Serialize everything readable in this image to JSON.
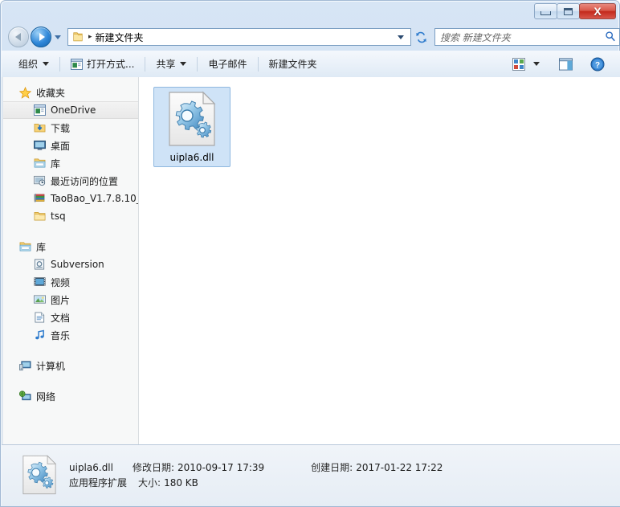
{
  "window": {
    "title": "",
    "buttons": {
      "minimize": "minimize",
      "maximize": "maximize",
      "close": "X"
    }
  },
  "address": {
    "back_label": "后退",
    "forward_label": "前进",
    "recent_label": "最近浏览的位置",
    "folder_icon": "folder-icon",
    "separator": "▸",
    "path": "新建文件夹",
    "dropdown_label": "地址栏下拉",
    "refresh_label": "刷新"
  },
  "search": {
    "placeholder": "搜索 新建文件夹",
    "icon": "search-icon"
  },
  "toolbar": {
    "organize": "组织",
    "open_with": "打开方式...",
    "share": "共享",
    "email": "电子邮件",
    "new_folder": "新建文件夹",
    "views_label": "更改您的视图",
    "preview_label": "显示预览窗格",
    "help_label": "帮助"
  },
  "sidebar": {
    "groups": [
      {
        "header": "收藏夹",
        "header_icon": "star-icon",
        "items": [
          {
            "label": "OneDrive",
            "icon": "onedrive-icon",
            "selected": true
          },
          {
            "label": "下载",
            "icon": "downloads-icon",
            "selected": false
          },
          {
            "label": "桌面",
            "icon": "desktop-icon",
            "selected": false
          },
          {
            "label": "库",
            "icon": "library-icon",
            "selected": false
          },
          {
            "label": "最近访问的位置",
            "icon": "recent-places-icon",
            "selected": false
          },
          {
            "label": "TaoBao_V1.7.8.10_",
            "icon": "books-icon",
            "selected": false
          },
          {
            "label": "tsq",
            "icon": "folder-icon",
            "selected": false
          }
        ]
      },
      {
        "header": "库",
        "header_icon": "library-icon",
        "items": [
          {
            "label": "Subversion",
            "icon": "subversion-icon",
            "selected": false
          },
          {
            "label": "视频",
            "icon": "video-icon",
            "selected": false
          },
          {
            "label": "图片",
            "icon": "pictures-icon",
            "selected": false
          },
          {
            "label": "文档",
            "icon": "documents-icon",
            "selected": false
          },
          {
            "label": "音乐",
            "icon": "music-icon",
            "selected": false
          }
        ]
      },
      {
        "header": "计算机",
        "header_icon": "computer-icon",
        "items": []
      },
      {
        "header": "网络",
        "header_icon": "network-icon",
        "items": []
      }
    ]
  },
  "files": [
    {
      "name": "uipla6.dll",
      "icon": "dll-gears-icon",
      "selected": true
    }
  ],
  "status": {
    "file_name": "uipla6.dll",
    "modified_key": "修改日期:",
    "modified_value": "2010-09-17 17:39",
    "created_key": "创建日期:",
    "created_value": "2017-01-22 17:22",
    "type": "应用程序扩展",
    "size_key": "大小:",
    "size_value": "180 KB",
    "icon": "dll-gears-icon"
  },
  "colors": {
    "frame": "#cfe0f2",
    "accent": "#2f87d8",
    "close_button": "#c3291c",
    "selection": "#cfe3f7",
    "sidebar_bg": "#f7f8f8"
  }
}
